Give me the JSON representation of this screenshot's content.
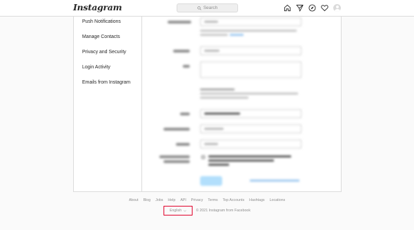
{
  "header": {
    "logo": "Instagram",
    "search_placeholder": "Search"
  },
  "icons": [
    "home-icon",
    "direct-icon",
    "explore-icon",
    "activity-heart-icon",
    "profile-avatar"
  ],
  "sidebar": {
    "items": [
      {
        "label": "Push Notifications"
      },
      {
        "label": "Manage Contacts"
      },
      {
        "label": "Privacy and Security"
      },
      {
        "label": "Login Activity"
      },
      {
        "label": "Emails from Instagram"
      }
    ]
  },
  "footer": {
    "links": [
      "About",
      "Blog",
      "Jobs",
      "Help",
      "API",
      "Privacy",
      "Terms",
      "Top Accounts",
      "Hashtags",
      "Locations"
    ],
    "language": "English",
    "copyright": "© 2021 Instagram from Facebook"
  },
  "colors": {
    "highlight_box": "#e0002a",
    "border": "#dbdbdb",
    "background": "#fafafa"
  }
}
